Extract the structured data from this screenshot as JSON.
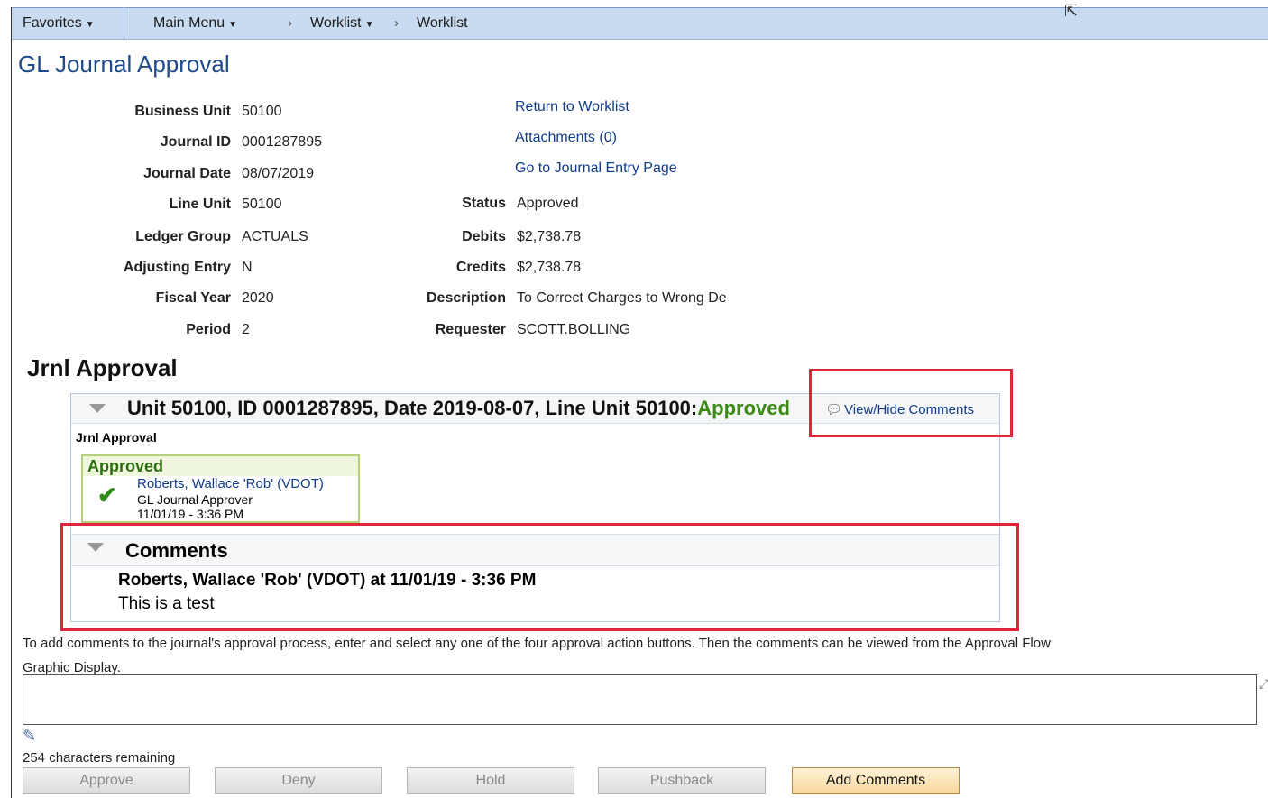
{
  "nav": {
    "favorites": "Favorites",
    "main_menu": "Main Menu",
    "crumb_worklist_menu": "Worklist",
    "crumb_worklist": "Worklist"
  },
  "page_title": "GL Journal Approval",
  "fields_left": [
    {
      "label": "Business Unit",
      "value": "50100"
    },
    {
      "label": "Journal ID",
      "value": "0001287895"
    },
    {
      "label": "Journal Date",
      "value": "08/07/2019"
    },
    {
      "label": "Line Unit",
      "value": "50100"
    },
    {
      "label": "Ledger Group",
      "value": "ACTUALS"
    },
    {
      "label": "Adjusting Entry",
      "value": "N"
    },
    {
      "label": "Fiscal Year",
      "value": "2020"
    },
    {
      "label": "Period",
      "value": "2"
    }
  ],
  "links": {
    "return_worklist": "Return to Worklist",
    "attachments": "Attachments (0)",
    "journal_entry": "Go to Journal Entry Page"
  },
  "fields_right": [
    {
      "label": "Status",
      "value": "Approved"
    },
    {
      "label": "Debits",
      "value": "$2,738.78"
    },
    {
      "label": "Credits",
      "value": "$2,738.78"
    },
    {
      "label": "Description",
      "value": "To Correct Charges to Wrong De"
    },
    {
      "label": "Requester",
      "value": "SCOTT.BOLLING"
    }
  ],
  "approval_section_title": "Jrnl Approval",
  "approval": {
    "header_text": "Unit 50100, ID 0001287895, Date 2019-08-07, Line Unit 50100:",
    "header_status": "Approved",
    "view_hide_comments": "View/Hide Comments",
    "stage_label": "Jrnl Approval",
    "stage_status": "Approved",
    "approver_name": "Roberts, Wallace 'Rob' (VDOT)",
    "approver_role": "GL Journal Approver",
    "approver_time": "11/01/19 - 3:36 PM",
    "comments_title": "Comments",
    "comment_author_line": "Roberts, Wallace 'Rob' (VDOT) at 11/01/19 - 3:36 PM",
    "comment_text": "This is a test"
  },
  "help_text": "To add comments to the journal's approval process, enter and select any one of the four approval action buttons. Then the comments can be viewed from the Approval Flow Graphic Display.",
  "comment_input_value": "",
  "chars_remaining": "254 characters remaining",
  "buttons": {
    "approve": "Approve",
    "deny": "Deny",
    "hold": "Hold",
    "pushback": "Pushback",
    "add_comments": "Add Comments"
  },
  "colors": {
    "link": "#103c8a",
    "approved_green": "#3b8a14",
    "highlight_red": "#e0253a",
    "navbar": "#c9dbf0"
  }
}
